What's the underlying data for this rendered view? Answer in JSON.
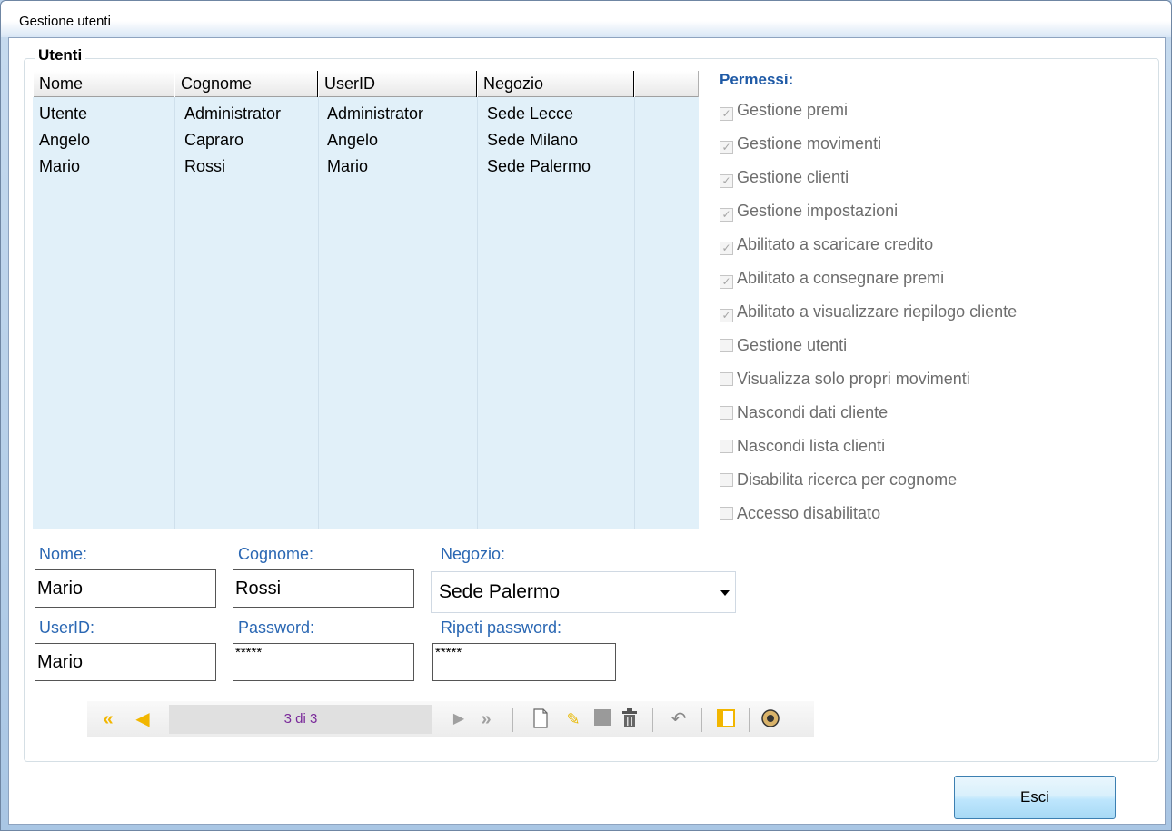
{
  "window": {
    "title": "Gestione utenti"
  },
  "users": {
    "legend": "Utenti",
    "columns": [
      "Nome",
      "Cognome",
      "UserID",
      "Negozio"
    ],
    "rows": [
      [
        "Utente",
        "Administrator",
        "Administrator",
        "Sede Lecce"
      ],
      [
        "Angelo",
        "Capraro",
        "Angelo",
        "Sede Milano"
      ],
      [
        "Mario",
        "Rossi",
        "Mario",
        "Sede Palermo"
      ]
    ]
  },
  "permissions": {
    "title": "Permessi:",
    "items": [
      {
        "label": "Gestione premi",
        "checked": true
      },
      {
        "label": "Gestione movimenti",
        "checked": true
      },
      {
        "label": "Gestione clienti",
        "checked": true
      },
      {
        "label": "Gestione impostazioni",
        "checked": true
      },
      {
        "label": "Abilitato a scaricare credito",
        "checked": true
      },
      {
        "label": "Abilitato a consegnare premi",
        "checked": true
      },
      {
        "label": "Abilitato a visualizzare riepilogo cliente",
        "checked": true
      },
      {
        "label": "Gestione utenti",
        "checked": false
      },
      {
        "label": "Visualizza solo propri movimenti",
        "checked": false
      },
      {
        "label": "Nascondi dati cliente",
        "checked": false
      },
      {
        "label": "Nascondi lista clienti",
        "checked": false
      },
      {
        "label": "Disabilita ricerca per cognome",
        "checked": false
      },
      {
        "label": "Accesso disabilitato",
        "checked": false
      }
    ]
  },
  "form": {
    "nome_label": "Nome:",
    "nome_value": "Mario",
    "cognome_label": "Cognome:",
    "cognome_value": "Rossi",
    "negozio_label": "Negozio:",
    "negozio_value": "Sede Palermo",
    "userid_label": "UserID:",
    "userid_value": "Mario",
    "password_label": "Password:",
    "password_value": "*****",
    "ripeti_label": "Ripeti password:",
    "ripeti_value": "*****"
  },
  "navigator": {
    "position": "3 di 3"
  },
  "buttons": {
    "exit": "Esci"
  }
}
